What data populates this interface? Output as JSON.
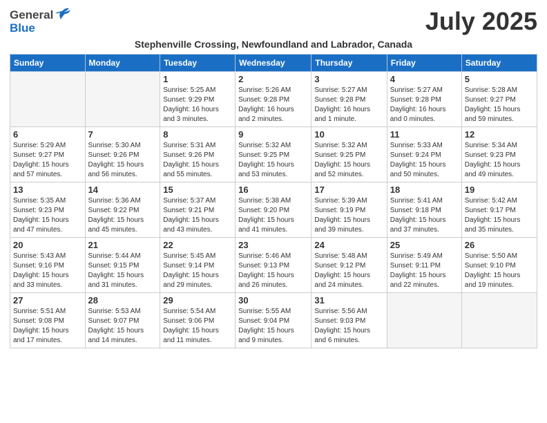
{
  "header": {
    "logo_general": "General",
    "logo_blue": "Blue",
    "month_title": "July 2025",
    "subtitle": "Stephenville Crossing, Newfoundland and Labrador, Canada"
  },
  "calendar": {
    "days_of_week": [
      "Sunday",
      "Monday",
      "Tuesday",
      "Wednesday",
      "Thursday",
      "Friday",
      "Saturday"
    ],
    "weeks": [
      [
        {
          "day": "",
          "info": ""
        },
        {
          "day": "",
          "info": ""
        },
        {
          "day": "1",
          "info": "Sunrise: 5:25 AM\nSunset: 9:29 PM\nDaylight: 16 hours\nand 3 minutes."
        },
        {
          "day": "2",
          "info": "Sunrise: 5:26 AM\nSunset: 9:28 PM\nDaylight: 16 hours\nand 2 minutes."
        },
        {
          "day": "3",
          "info": "Sunrise: 5:27 AM\nSunset: 9:28 PM\nDaylight: 16 hours\nand 1 minute."
        },
        {
          "day": "4",
          "info": "Sunrise: 5:27 AM\nSunset: 9:28 PM\nDaylight: 16 hours\nand 0 minutes."
        },
        {
          "day": "5",
          "info": "Sunrise: 5:28 AM\nSunset: 9:27 PM\nDaylight: 15 hours\nand 59 minutes."
        }
      ],
      [
        {
          "day": "6",
          "info": "Sunrise: 5:29 AM\nSunset: 9:27 PM\nDaylight: 15 hours\nand 57 minutes."
        },
        {
          "day": "7",
          "info": "Sunrise: 5:30 AM\nSunset: 9:26 PM\nDaylight: 15 hours\nand 56 minutes."
        },
        {
          "day": "8",
          "info": "Sunrise: 5:31 AM\nSunset: 9:26 PM\nDaylight: 15 hours\nand 55 minutes."
        },
        {
          "day": "9",
          "info": "Sunrise: 5:32 AM\nSunset: 9:25 PM\nDaylight: 15 hours\nand 53 minutes."
        },
        {
          "day": "10",
          "info": "Sunrise: 5:32 AM\nSunset: 9:25 PM\nDaylight: 15 hours\nand 52 minutes."
        },
        {
          "day": "11",
          "info": "Sunrise: 5:33 AM\nSunset: 9:24 PM\nDaylight: 15 hours\nand 50 minutes."
        },
        {
          "day": "12",
          "info": "Sunrise: 5:34 AM\nSunset: 9:23 PM\nDaylight: 15 hours\nand 49 minutes."
        }
      ],
      [
        {
          "day": "13",
          "info": "Sunrise: 5:35 AM\nSunset: 9:23 PM\nDaylight: 15 hours\nand 47 minutes."
        },
        {
          "day": "14",
          "info": "Sunrise: 5:36 AM\nSunset: 9:22 PM\nDaylight: 15 hours\nand 45 minutes."
        },
        {
          "day": "15",
          "info": "Sunrise: 5:37 AM\nSunset: 9:21 PM\nDaylight: 15 hours\nand 43 minutes."
        },
        {
          "day": "16",
          "info": "Sunrise: 5:38 AM\nSunset: 9:20 PM\nDaylight: 15 hours\nand 41 minutes."
        },
        {
          "day": "17",
          "info": "Sunrise: 5:39 AM\nSunset: 9:19 PM\nDaylight: 15 hours\nand 39 minutes."
        },
        {
          "day": "18",
          "info": "Sunrise: 5:41 AM\nSunset: 9:18 PM\nDaylight: 15 hours\nand 37 minutes."
        },
        {
          "day": "19",
          "info": "Sunrise: 5:42 AM\nSunset: 9:17 PM\nDaylight: 15 hours\nand 35 minutes."
        }
      ],
      [
        {
          "day": "20",
          "info": "Sunrise: 5:43 AM\nSunset: 9:16 PM\nDaylight: 15 hours\nand 33 minutes."
        },
        {
          "day": "21",
          "info": "Sunrise: 5:44 AM\nSunset: 9:15 PM\nDaylight: 15 hours\nand 31 minutes."
        },
        {
          "day": "22",
          "info": "Sunrise: 5:45 AM\nSunset: 9:14 PM\nDaylight: 15 hours\nand 29 minutes."
        },
        {
          "day": "23",
          "info": "Sunrise: 5:46 AM\nSunset: 9:13 PM\nDaylight: 15 hours\nand 26 minutes."
        },
        {
          "day": "24",
          "info": "Sunrise: 5:48 AM\nSunset: 9:12 PM\nDaylight: 15 hours\nand 24 minutes."
        },
        {
          "day": "25",
          "info": "Sunrise: 5:49 AM\nSunset: 9:11 PM\nDaylight: 15 hours\nand 22 minutes."
        },
        {
          "day": "26",
          "info": "Sunrise: 5:50 AM\nSunset: 9:10 PM\nDaylight: 15 hours\nand 19 minutes."
        }
      ],
      [
        {
          "day": "27",
          "info": "Sunrise: 5:51 AM\nSunset: 9:08 PM\nDaylight: 15 hours\nand 17 minutes."
        },
        {
          "day": "28",
          "info": "Sunrise: 5:53 AM\nSunset: 9:07 PM\nDaylight: 15 hours\nand 14 minutes."
        },
        {
          "day": "29",
          "info": "Sunrise: 5:54 AM\nSunset: 9:06 PM\nDaylight: 15 hours\nand 11 minutes."
        },
        {
          "day": "30",
          "info": "Sunrise: 5:55 AM\nSunset: 9:04 PM\nDaylight: 15 hours\nand 9 minutes."
        },
        {
          "day": "31",
          "info": "Sunrise: 5:56 AM\nSunset: 9:03 PM\nDaylight: 15 hours\nand 6 minutes."
        },
        {
          "day": "",
          "info": ""
        },
        {
          "day": "",
          "info": ""
        }
      ]
    ]
  }
}
